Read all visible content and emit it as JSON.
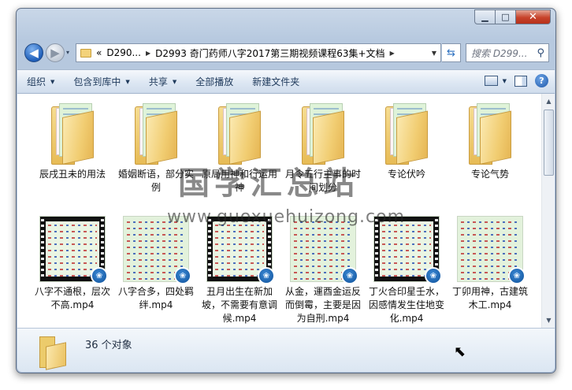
{
  "window": {
    "minimize_label": "▁",
    "maximize_label": "□",
    "close_label": "✕"
  },
  "address": {
    "back_label": "◀",
    "forward_label": "▶",
    "history_label": "▾",
    "overflow": "«",
    "segments": [
      "D290...",
      "D2993 奇门药师八字2017第三期视频课程63集+文档"
    ],
    "search_placeholder": "搜索 D299...",
    "search_icon": "search-icon"
  },
  "toolbar": {
    "organize": "组织",
    "include_in_library": "包含到库中",
    "share": "共享",
    "play_all": "全部播放",
    "new_folder": "新建文件夹",
    "help": "?"
  },
  "items": [
    {
      "label": "辰戌丑未的用法",
      "kind": "folder"
    },
    {
      "label": "婚姻断语，部分实例",
      "kind": "folder"
    },
    {
      "label": "原局用神和行运用神",
      "kind": "folder"
    },
    {
      "label": "月令五行主事的时间划分",
      "kind": "folder"
    },
    {
      "label": "专论伏吟",
      "kind": "folder"
    },
    {
      "label": "专论气势",
      "kind": "folder"
    },
    {
      "label": "八字不通根，层次不高.mp4",
      "kind": "video",
      "thumb": "film"
    },
    {
      "label": "八字合多，四处羁绊.mp4",
      "kind": "video",
      "thumb": "doc"
    },
    {
      "label": "丑月出生在新加坡，不需要有意调候.mp4",
      "kind": "video",
      "thumb": "film"
    },
    {
      "label": "从金，運酉金运反而倒霉，主要是因为自刑.mp4",
      "kind": "video",
      "thumb": "doc"
    },
    {
      "label": "丁火合印星壬水，因感情发生住地变化.mp4",
      "kind": "video",
      "thumb": "film"
    },
    {
      "label": "丁卯用神，古建筑木工.mp4",
      "kind": "video",
      "thumb": "doc"
    }
  ],
  "status": {
    "count": "36 个对象"
  },
  "watermark": {
    "title": "国学汇总站",
    "url": "www.guoxuehuizong.com"
  },
  "colors": {
    "accent": "#1e395b",
    "folder": "#f1cd72",
    "close": "#c7432a"
  }
}
